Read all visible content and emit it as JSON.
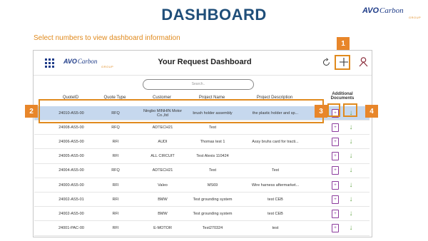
{
  "slide": {
    "title": "DASHBOARD",
    "instruction": "Select numbers to view dashboard information"
  },
  "brand": {
    "mark": "AVO",
    "word": "Carbon",
    "sub": "GROUP"
  },
  "app": {
    "title": "Your Request Dashboard",
    "search_placeholder": "Search..",
    "icons": [
      "grid-icon",
      "refresh-icon",
      "add-icon",
      "user-icon"
    ]
  },
  "table": {
    "headers": {
      "quote_id": "QuoteID",
      "quote_type": "Quote Type",
      "customer": "Customer",
      "project_name": "Project Name",
      "project_description": "Project Description",
      "additional_documents": "Additional Documents"
    },
    "rows": [
      {
        "quote_id": "24010-AS5-00",
        "quote_type": "RFQ",
        "customer": "Ningbo MINHIN Motor Co.,ltd",
        "project_name": "brush holder assembly",
        "project_description": "the plastic holder and sp...",
        "selected": true
      },
      {
        "quote_id": "24008-AS5-00",
        "quote_type": "RFQ",
        "customer": "ADTECH21",
        "project_name": "Test",
        "project_description": ""
      },
      {
        "quote_id": "24006-AS5-00",
        "quote_type": "RFI",
        "customer": "AUDI",
        "project_name": "Thomas test 1",
        "project_description": "Assy bruhs card for tracti..."
      },
      {
        "quote_id": "24005-AS5-00",
        "quote_type": "RFI",
        "customer": "ALL CIRCUIT",
        "project_name": "Test Alexis 110424",
        "project_description": ""
      },
      {
        "quote_id": "24004-AS5-00",
        "quote_type": "RFQ",
        "customer": "ADTECH21",
        "project_name": "Test",
        "project_description": "Test"
      },
      {
        "quote_id": "24000-AS5-00",
        "quote_type": "RFI",
        "customer": "Valeo",
        "project_name": "MS69",
        "project_description": "Wire harness aftermarket..."
      },
      {
        "quote_id": "24002-AS5-01",
        "quote_type": "RFI",
        "customer": "BMW",
        "project_name": "Test grounding system",
        "project_description": "test CEB"
      },
      {
        "quote_id": "24002-AS5-00",
        "quote_type": "RFI",
        "customer": "BMW",
        "project_name": "Test grounding system",
        "project_description": "test CEB"
      },
      {
        "quote_id": "24001-PAC-00",
        "quote_type": "RFI",
        "customer": "E-MOTOR",
        "project_name": "Test270324",
        "project_description": "test"
      }
    ]
  },
  "callouts": [
    "1",
    "2",
    "3",
    "4"
  ],
  "colors": {
    "title": "#1f4e79",
    "accent": "#e08a1e",
    "badge": "#e8862a",
    "selected_row": "#c6d8ee",
    "doc_icon": "#8b3a9c",
    "download_icon": "#6aa84f"
  }
}
